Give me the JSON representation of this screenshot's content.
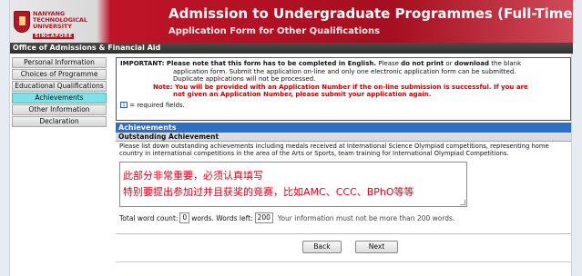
{
  "header": {
    "logo": {
      "line1": "NANYANG",
      "line2": "TECHNOLOGICAL",
      "line3": "UNIVERSITY",
      "line4": "SINGAPORE"
    },
    "title": "Admission to Undergraduate Programmes (Full-Time)",
    "subtitle": "Application Form for Other Qualifications"
  },
  "office_bar": "Office of Admissions & Financial Aid",
  "sidebar": {
    "items": [
      {
        "label": "Personal Information",
        "active": false
      },
      {
        "label": "Choices of Programme",
        "active": false
      },
      {
        "label": "Educational Qualifications",
        "active": false
      },
      {
        "label": "Achievements",
        "active": true
      },
      {
        "label": "Other Information",
        "active": false
      },
      {
        "label": "Declaration",
        "active": false
      }
    ]
  },
  "notice": {
    "line1_prefix": "IMPORTANT: Please note that this form has to be completed in English.",
    "line1_mid": " Please ",
    "line1_bold2": "do not print",
    "line1_or": " or ",
    "line1_bold3": "download",
    "line1_suffix": " the blank",
    "line2": "application form. Submit the application on-line and only one electronic application form can be submitted.",
    "line3": "Duplicate applications will not be processed.",
    "note_line1": "Note: You will be provided with an Application Number if the on-line submission is successful. If you are",
    "note_line2": "not given an Application Number, please submit your application again.",
    "required_icon_text": "1",
    "required_text": "= required fields."
  },
  "section": {
    "title": "Achievements",
    "subtitle": "Outstanding Achievement",
    "description": "Please list down outstanding achievements including medals received at International Science Olympiad competitions, representing home country in international competitions in the area of the Arts or Sports, team training for International Olympiad Competitions."
  },
  "textarea": {
    "line1": "此部分非常重要，必须认真填写",
    "line2": "特别要提出参加过并且获奖的竞赛，比如AMC、CCC、BPhO等等"
  },
  "word_count": {
    "total_label": "Total word count:",
    "total_value": "0",
    "words_label": "words. Words left:",
    "left_value": "200",
    "note": "Your information must not be more than 200 words."
  },
  "buttons": {
    "back": "Back",
    "next": "Next"
  },
  "colors": {
    "header_red": "#a50f1f",
    "section_blue": "#2a6fc9",
    "active_tab": "#7fe0e8",
    "annotation_red": "#e0001a"
  }
}
